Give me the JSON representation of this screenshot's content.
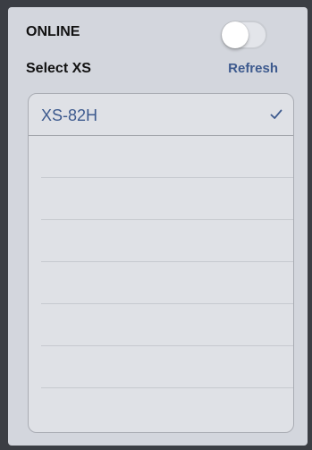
{
  "settings": {
    "online_label": "ONLINE",
    "online_enabled": false,
    "select_label": "Select XS",
    "refresh_label": "Refresh"
  },
  "device_list": {
    "items": [
      {
        "label": "XS-82H",
        "selected": true
      }
    ],
    "empty_rows": 7
  },
  "colors": {
    "accent": "#3d5a8e",
    "panel_background": "#d3d6dd",
    "list_background": "#dfe1e6"
  },
  "icons": {
    "selected_indicator": "checkmark-icon"
  }
}
